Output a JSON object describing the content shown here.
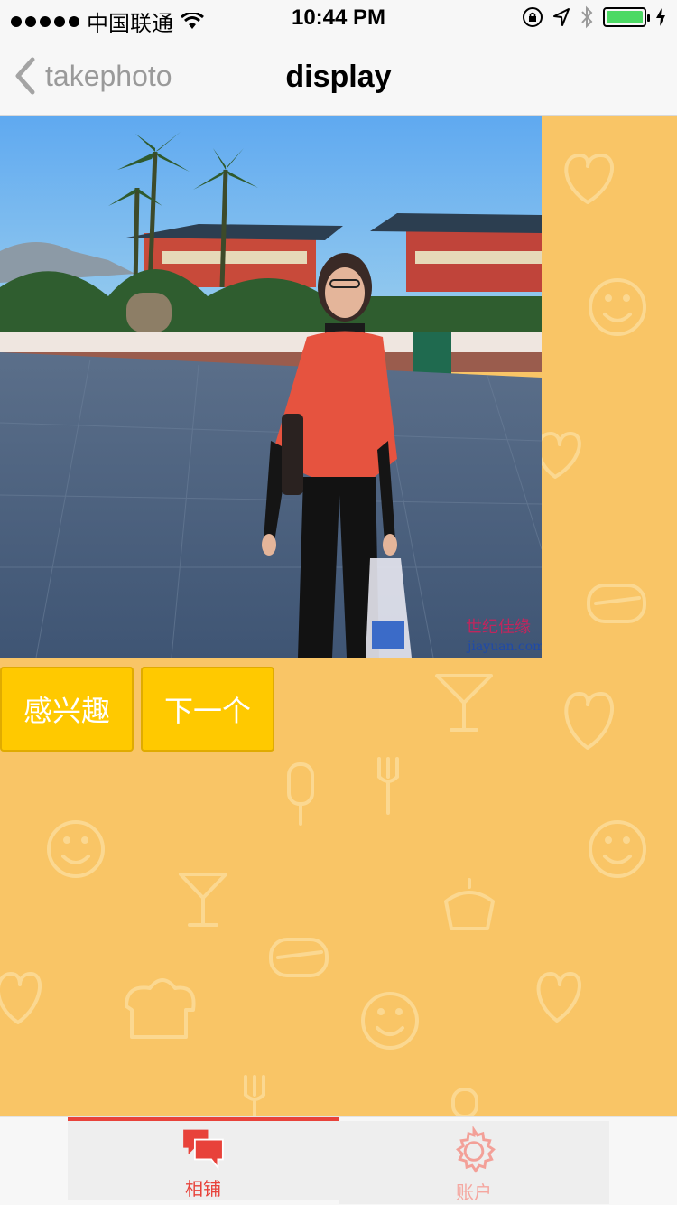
{
  "status_bar": {
    "carrier": "中国联通",
    "time": "10:44 PM",
    "battery_level": 1.0
  },
  "nav": {
    "back_label": "takephoto",
    "title": "display"
  },
  "photo": {
    "watermark_text": "世纪佳缘",
    "watermark_url": "jiayuan.com"
  },
  "actions": {
    "interest_label": "感兴趣",
    "next_label": "下一个"
  },
  "tabs": [
    {
      "label": "相铺",
      "icon": "chat-bubbles-icon",
      "active": true
    },
    {
      "label": "账户",
      "icon": "gear-icon",
      "active": false
    }
  ],
  "colors": {
    "background": "#f9c566",
    "button": "#ffc900",
    "accent": "#e8423a"
  }
}
